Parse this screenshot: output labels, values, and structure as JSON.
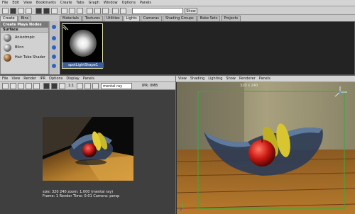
{
  "hypershade": {
    "menu": [
      "File",
      "Edit",
      "View",
      "Bookmarks",
      "Create",
      "Tabs",
      "Graph",
      "Window",
      "Options",
      "Panels"
    ],
    "show_button": "Show",
    "left_tabs": [
      "Create",
      "Bins"
    ],
    "nodes_header": "Create Maya Nodes",
    "surface_header": "Surface",
    "nodes": [
      "Anisotropic",
      "Blinn",
      "Hair Tube Shader"
    ],
    "tabs": [
      "Materials",
      "Textures",
      "Utilities",
      "Lights",
      "Cameras",
      "Shading Groups",
      "Bake Sets",
      "Projects"
    ],
    "active_tab": "Lights",
    "swatch_label": "spotLightShape1"
  },
  "render_view": {
    "menu": [
      "File",
      "View",
      "Render",
      "IPR",
      "Options",
      "Display",
      "Panels"
    ],
    "ratio": "1:1",
    "renderer": "mental ray",
    "ipr_label": "IPR: 0MB",
    "info_line1": "size:  320  240  zoom: 1.000     (mental ray)",
    "info_line2": "Frame: 1      Render Time: 0:01      Camera: persp"
  },
  "viewport": {
    "menu": [
      "View",
      "Shading",
      "Lighting",
      "Show",
      "Renderer",
      "Panels"
    ],
    "readout": "320 x 240"
  },
  "colors": {
    "accent": "#2b63c5",
    "swatch_border": "#e6e6b0",
    "gate": "#2fae3a"
  }
}
